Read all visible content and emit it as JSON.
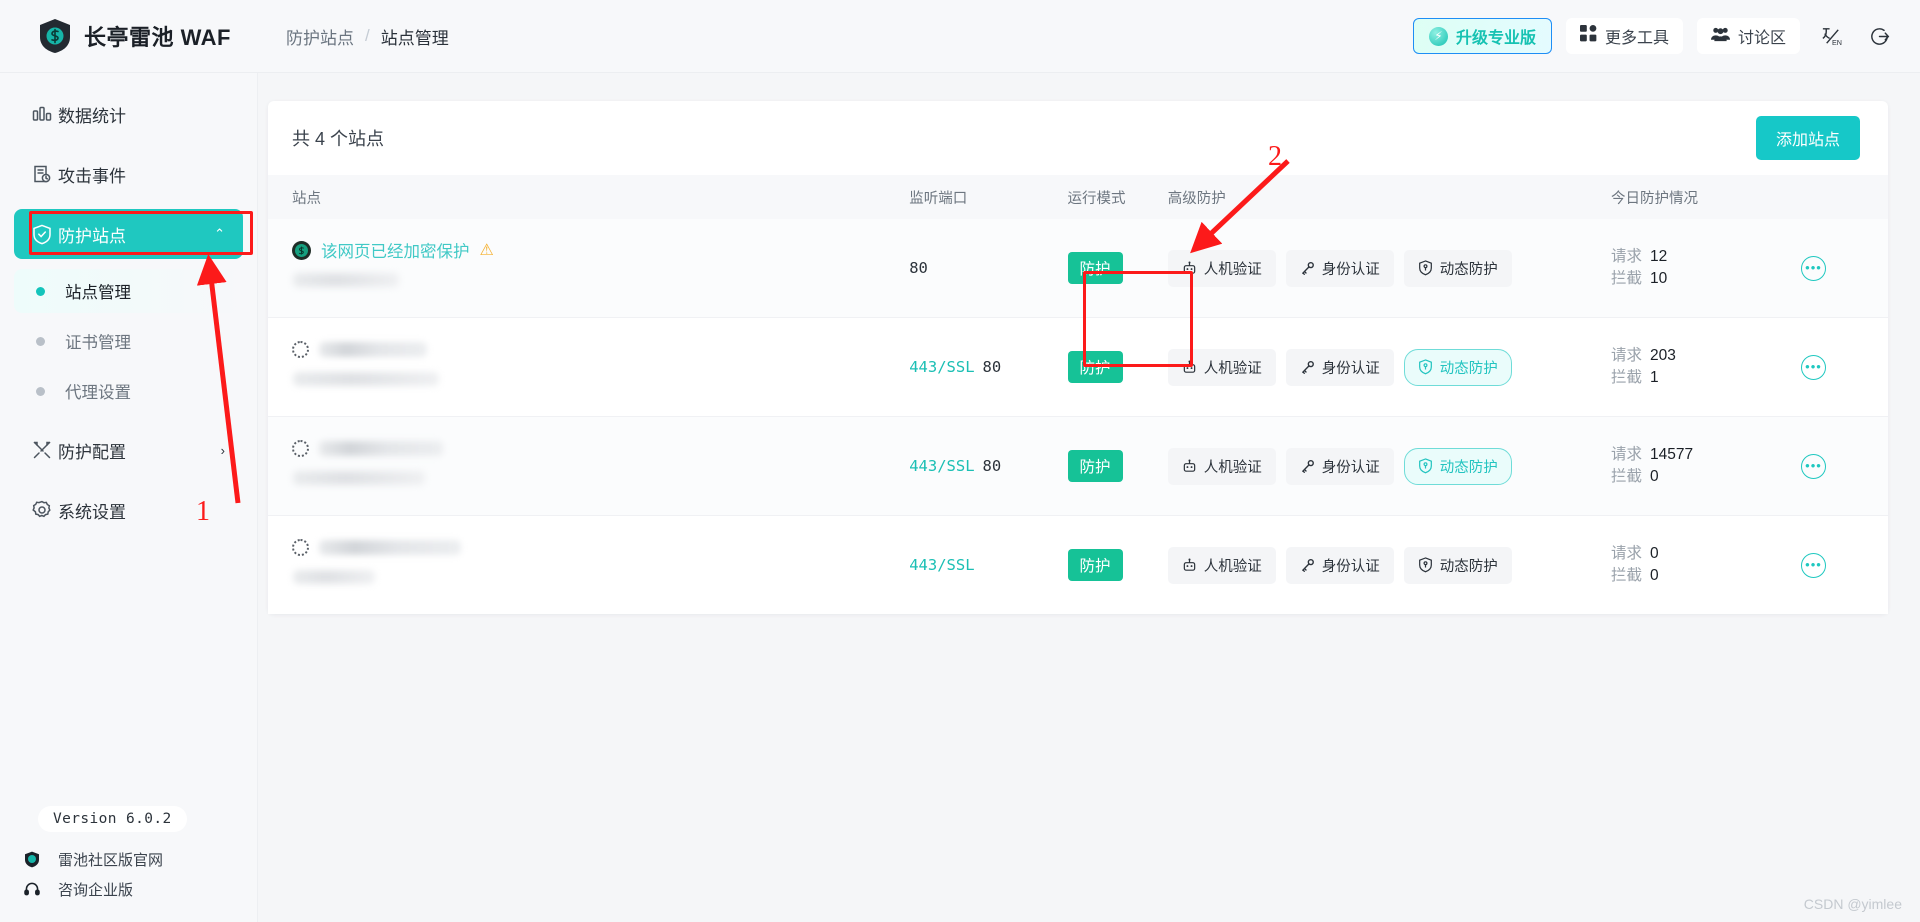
{
  "header": {
    "brand": "长亭雷池 WAF",
    "logo_icon": "shield-logo-icon",
    "breadcrumb": {
      "parent": "防护站点",
      "separator": "/",
      "current": "站点管理"
    },
    "upgrade_button": {
      "label": "升级专业版",
      "icon": "lightning-badge-icon"
    },
    "more_tools_button": {
      "label": "更多工具",
      "icon": "grid-apps-icon"
    },
    "forum_button": {
      "label": "讨论区",
      "icon": "people-group-icon"
    },
    "lang_button_icon": "language-switch-icon",
    "logout_button_icon": "logout-icon"
  },
  "sidebar": {
    "items": [
      {
        "label": "数据统计",
        "icon": "bar-chart-icon",
        "active": false
      },
      {
        "label": "攻击事件",
        "icon": "attack-log-icon",
        "active": false
      },
      {
        "label": "防护站点",
        "icon": "shield-check-icon",
        "active": true,
        "caret": "⌃"
      },
      {
        "label": "防护配置",
        "icon": "tools-icon",
        "active": false,
        "caret": "›"
      },
      {
        "label": "系统设置",
        "icon": "gear-icon",
        "active": false
      }
    ],
    "sub_items": [
      {
        "label": "站点管理",
        "selected": true
      },
      {
        "label": "证书管理",
        "selected": false
      },
      {
        "label": "代理设置",
        "selected": false
      }
    ],
    "footer": {
      "version": "Version 6.0.2",
      "links": [
        {
          "label": "雷池社区版官网",
          "icon": "shield-small-icon"
        },
        {
          "label": "咨询企业版",
          "icon": "headset-icon"
        }
      ]
    }
  },
  "main": {
    "total_text": "共 4 个站点",
    "add_button": "添加站点",
    "columns": [
      "站点",
      "监听端口",
      "运行模式",
      "高级防护",
      "今日防护情况",
      ""
    ],
    "stat_labels": {
      "requests": "请求",
      "blocked": "拦截"
    },
    "rows": [
      {
        "favicon": "encrypted-site-icon",
        "site_label": "该网页已经加密保护",
        "has_warning": true,
        "warning_icon": "warning-triangle-icon",
        "ssl_port": "",
        "http_port": "80",
        "mode": "防护",
        "chips": [
          {
            "label": "人机验证",
            "icon": "robot-icon",
            "on": false
          },
          {
            "label": "身份认证",
            "icon": "key-icon",
            "on": false
          },
          {
            "label": "动态防护",
            "icon": "shield-outline-icon",
            "on": false
          }
        ],
        "requests": "12",
        "blocked": "10",
        "more_icon": "more-dots-icon"
      },
      {
        "favicon": "loading-spinner-icon",
        "site_label": "",
        "has_warning": false,
        "ssl_port": "443/SSL",
        "http_port": "80",
        "mode": "防护",
        "chips": [
          {
            "label": "人机验证",
            "icon": "robot-icon",
            "on": false
          },
          {
            "label": "身份认证",
            "icon": "key-icon",
            "on": false
          },
          {
            "label": "动态防护",
            "icon": "shield-outline-icon",
            "on": true
          }
        ],
        "requests": "203",
        "blocked": "1",
        "more_icon": "more-dots-icon"
      },
      {
        "favicon": "loading-spinner-icon",
        "site_label": "",
        "has_warning": false,
        "ssl_port": "443/SSL",
        "http_port": "80",
        "mode": "防护",
        "chips": [
          {
            "label": "人机验证",
            "icon": "robot-icon",
            "on": false
          },
          {
            "label": "身份认证",
            "icon": "key-icon",
            "on": false
          },
          {
            "label": "动态防护",
            "icon": "shield-outline-icon",
            "on": true
          }
        ],
        "requests": "14577",
        "blocked": "0",
        "more_icon": "more-dots-icon"
      },
      {
        "favicon": "loading-spinner-icon",
        "site_label": "",
        "has_warning": false,
        "ssl_port": "443/SSL",
        "http_port": "",
        "mode": "防护",
        "chips": [
          {
            "label": "人机验证",
            "icon": "robot-icon",
            "on": false
          },
          {
            "label": "身份认证",
            "icon": "key-icon",
            "on": false
          },
          {
            "label": "动态防护",
            "icon": "shield-outline-icon",
            "on": false
          }
        ],
        "requests": "0",
        "blocked": "0",
        "more_icon": "more-dots-icon"
      }
    ]
  },
  "annotations": {
    "marker_one": "1",
    "marker_two": "2",
    "color": "#fc1a1a"
  },
  "watermark": "CSDN @yimlee"
}
